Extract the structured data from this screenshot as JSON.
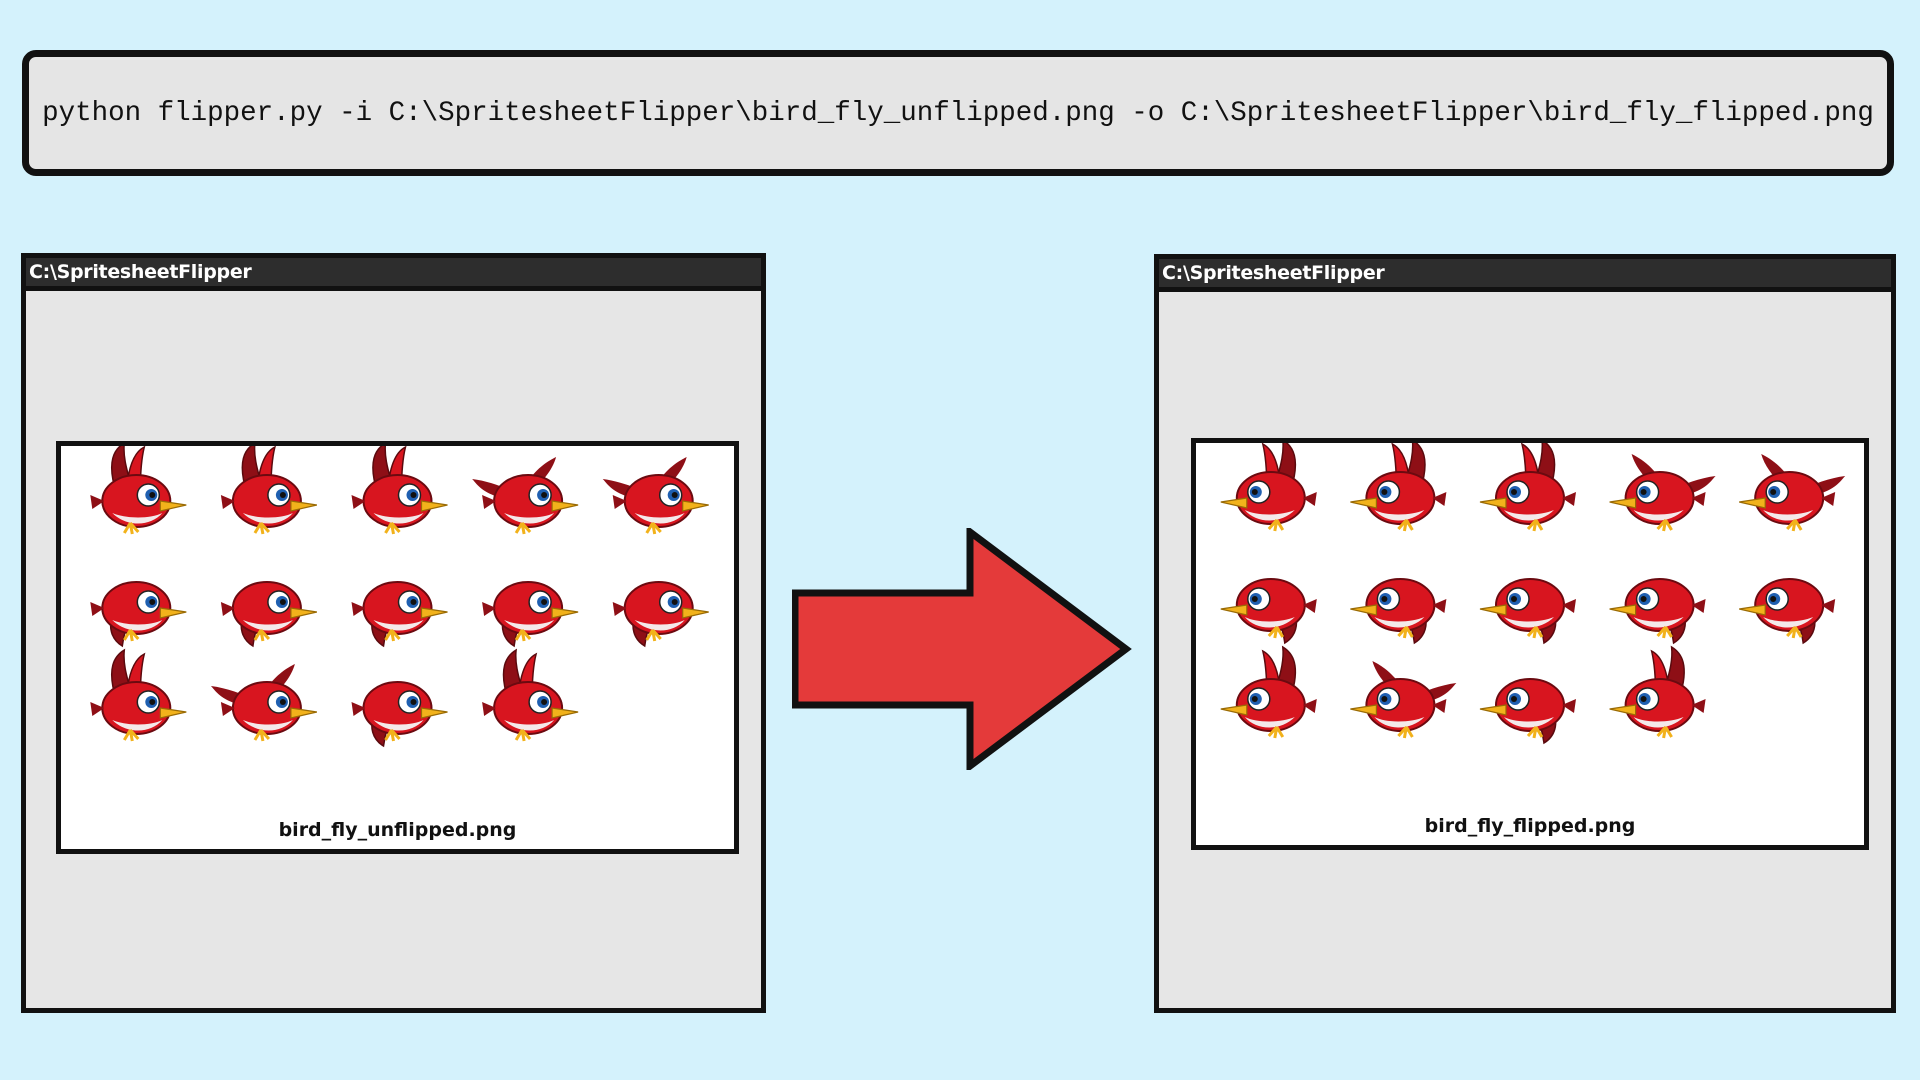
{
  "command": {
    "text": "python flipper.py -i C:\\SpritesheetFlipper\\bird_fly_unflipped.png -o C:\\SpritesheetFlipper\\bird_fly_flipped.png"
  },
  "left_window": {
    "title": "C:\\SpritesheetFlipper",
    "file_name": "bird_fly_unflipped.png",
    "sprite_rows": [
      5,
      5,
      4
    ],
    "facing": "right"
  },
  "right_window": {
    "title": "C:\\SpritesheetFlipper",
    "file_name": "bird_fly_flipped.png",
    "sprite_rows": [
      5,
      5,
      4
    ],
    "facing": "left"
  },
  "arrow": {
    "icon": "right-arrow-icon",
    "color": "#e43a3a"
  },
  "colors": {
    "background": "#d4f2fc",
    "panel": "#e6e6e6",
    "bird_red": "#d8151f",
    "beak": "#f2b21b"
  }
}
